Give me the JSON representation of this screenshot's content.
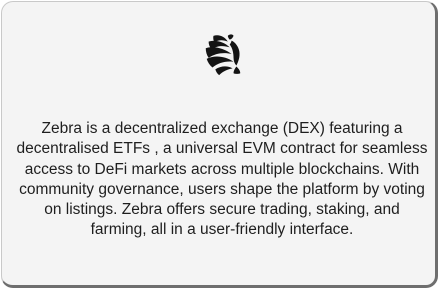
{
  "card": {
    "logo_icon": "zebra-logo-icon",
    "description": "Zebra is a decentralized exchange (DEX) featuring a decentralised ETFs , a universal EVM contract for seamless access to DeFi markets across multiple blockchains. With community governance, users shape the platform by voting on listings. Zebra offers secure trading, staking, and farming, all in a user-friendly interface."
  },
  "colors": {
    "card_background": "#f4f4f4",
    "card_border": "#6e6e6e",
    "text": "#1e1e1e",
    "logo": "#141414"
  }
}
